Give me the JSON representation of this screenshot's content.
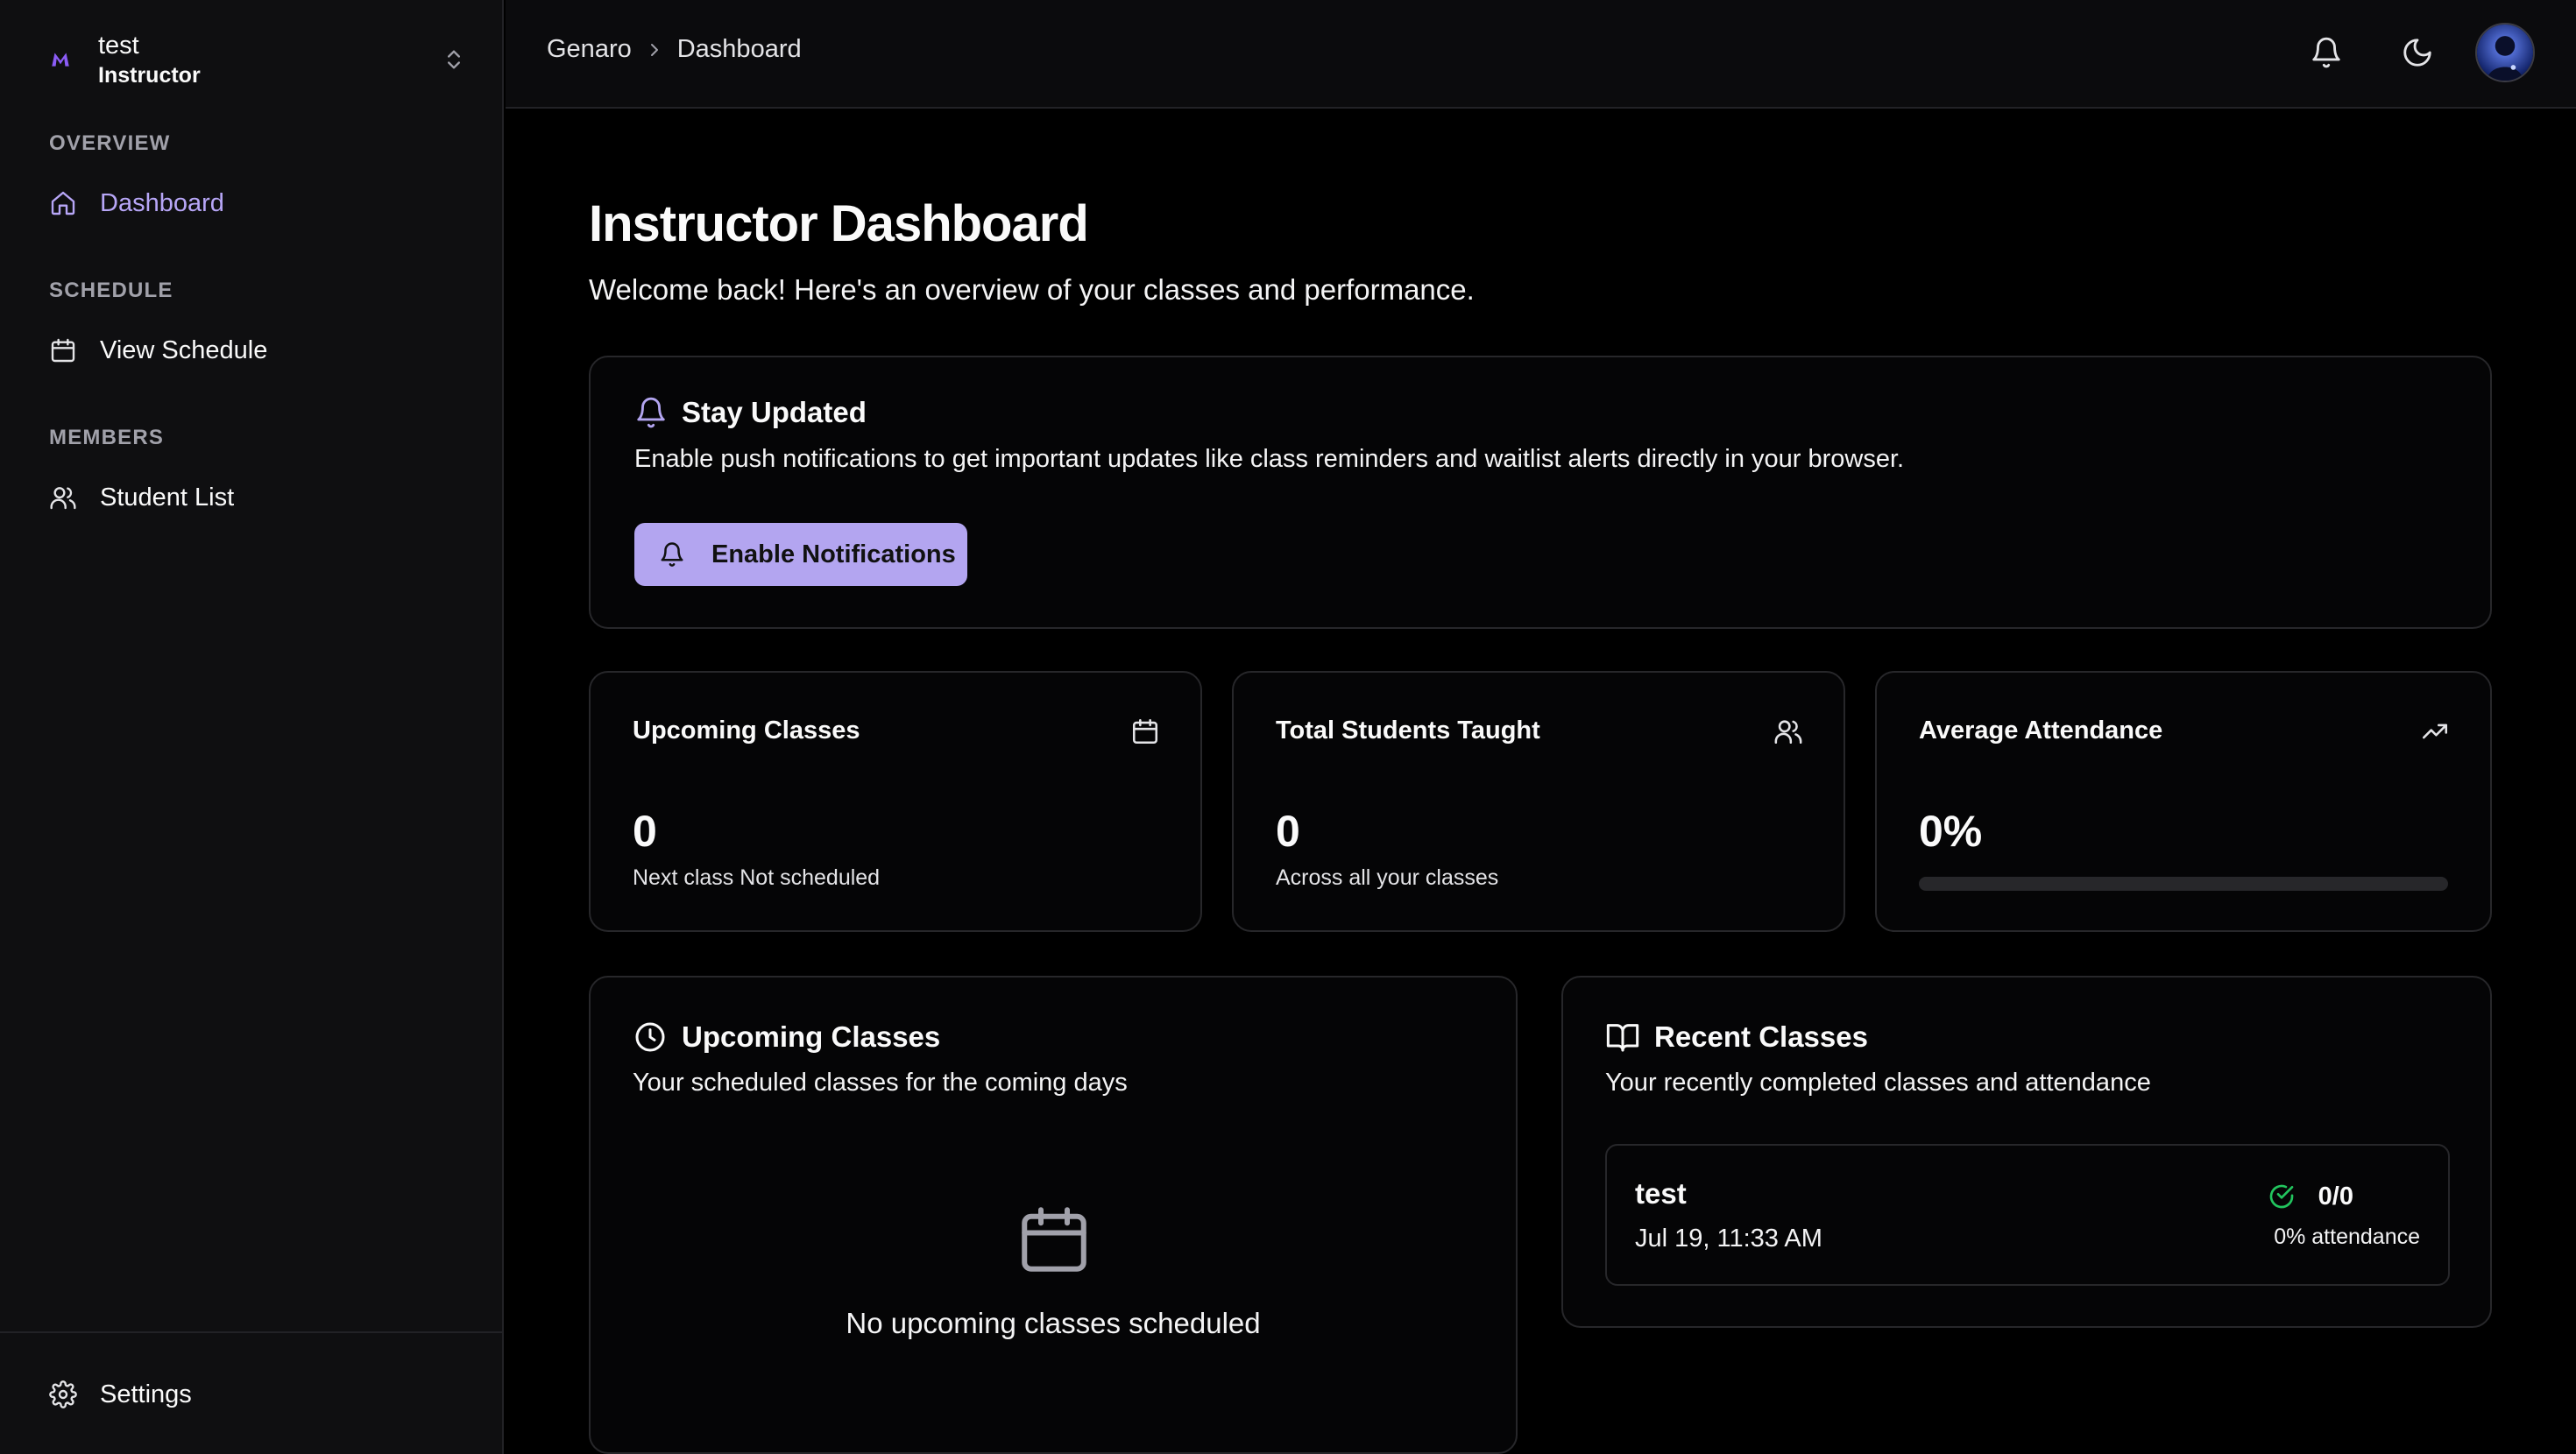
{
  "sidebar": {
    "team": {
      "name": "test",
      "role": "Instructor"
    },
    "groups": [
      {
        "label": "OVERVIEW",
        "items": [
          {
            "label": "Dashboard",
            "icon": "home-icon",
            "active": true
          }
        ]
      },
      {
        "label": "SCHEDULE",
        "items": [
          {
            "label": "View Schedule",
            "icon": "calendar-icon"
          }
        ]
      },
      {
        "label": "MEMBERS",
        "items": [
          {
            "label": "Student List",
            "icon": "users-icon"
          }
        ]
      }
    ],
    "footer": {
      "label": "Settings",
      "icon": "gear-icon"
    }
  },
  "header": {
    "breadcrumb": [
      "Genaro",
      "Dashboard"
    ],
    "icons": [
      "bell-icon",
      "moon-icon",
      "avatar"
    ]
  },
  "page": {
    "title": "Instructor Dashboard",
    "subtitle": "Welcome back! Here's an overview of your classes and performance."
  },
  "notifications": {
    "title": "Stay Updated",
    "description": "Enable push notifications to get important updates like class reminders and waitlist alerts directly in your browser.",
    "button_label": "Enable Notifications"
  },
  "stats": {
    "upcoming": {
      "label": "Upcoming Classes",
      "value": "0",
      "note": "Next class Not scheduled",
      "icon": "calendar-icon"
    },
    "students": {
      "label": "Total Students Taught",
      "value": "0",
      "note": "Across all your classes",
      "icon": "users-icon"
    },
    "attendance": {
      "label": "Average Attendance",
      "value": "0%",
      "progress": 0,
      "icon": "trending-up-icon"
    }
  },
  "upcoming_section": {
    "title": "Upcoming Classes",
    "description": "Your scheduled classes for the coming days",
    "empty_text": "No upcoming classes scheduled"
  },
  "recent_section": {
    "title": "Recent Classes",
    "description": "Your recently completed classes and attendance",
    "items": [
      {
        "name": "test",
        "date": "Jul 19, 11:33 AM",
        "count": "0/0",
        "attendance": "0% attendance"
      }
    ]
  },
  "colors": {
    "accent": "#b3a5f0",
    "active_text": "#b7a6f7",
    "success": "#22c55e",
    "background": "#000000",
    "sidebar": "#0f0f11"
  }
}
